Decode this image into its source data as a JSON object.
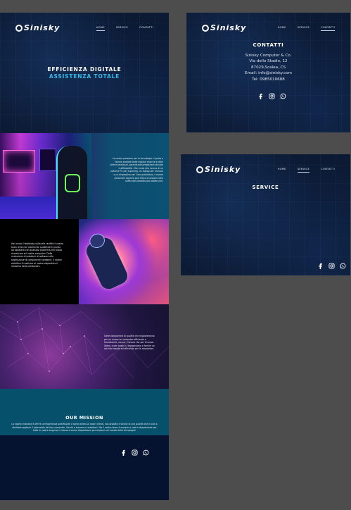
{
  "brand": "Sinisky",
  "nav": {
    "home": "HOME",
    "service": "SERVICE",
    "contatti": "CONTATTI"
  },
  "home": {
    "hero_line1": "EFFICIENZA DIGITALE",
    "hero_line2": "ASSISTENZA TOTALE",
    "section1_text": "La nostra passione per la tecnologia ci guida a fornire prodotti delle migliori marche e delle ultime tendenze, garantendo prestazioni elevate e affidabilità. Che tu sia alla ricerca di un potente PC per il gaming, un laptop per il lavoro o un dispositivo per l'uso quotidiano, il nostro personale esperto sarà felice di aiutarti nella scelta del prodotto più adatto a te.",
    "section2_text": "Hai avuto il fastidioso sulla elle cenffini il vostro team di tecnici altamente qualificati è pronto ad assisterti con qualsiasi problema che possa riscontrare sul vostro computer. Dalla risoluzione di problemi di software alla sostituzione di componenti hardware, il nostro obiettivo è restituire al vostro dispositivo il massimo delle prestazioni.",
    "section3_text": "Siete componenti di qualità che miglioreranno per un nuovo un computer efficiente e funzionante, sia per il lavoro che per il tempo libero, e per quello ci impegniamo a fornire un servizio rapido ed efficiente per le riparazioni.",
    "mission_title": "OUR MISSION",
    "mission_text": "La nostra missione è offrire un'esperienza gratificante e senza stress ai nostri clienti, con prodotti e servizi di una qualità che li aiuti a sfruttare appieno il potenziale del loro computer. Vienici a trovare o contattaci. Ma il nostro team è sempre a vostra disposizione per tutte le vostre esigenze e siamo a vostra disposizione per aiutarvi nel mondo della tecnologia!"
  },
  "contatti": {
    "title": "CONTATTI",
    "company": "Sinisky Computer & Co.",
    "address": "Via dello Stadio, 12",
    "city": "87029,Scalea, CS",
    "email": "Email: info@sinisky.com",
    "tel": "Tel: 0985010688"
  },
  "service": {
    "title": "SERVICE"
  },
  "social_icons": [
    "facebook-icon",
    "instagram-icon",
    "whatsapp-icon"
  ]
}
